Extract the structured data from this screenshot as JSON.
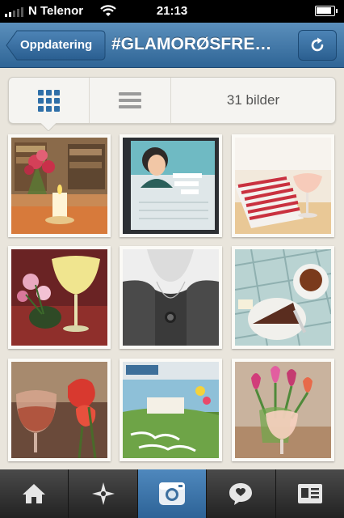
{
  "status_bar": {
    "carrier": "N Telenor",
    "time": "21:13",
    "battery_level": 0.9,
    "signal_bars": 2
  },
  "nav": {
    "back_label": "Oppdatering",
    "title": "#GLAMORØSFREDAG",
    "refresh_icon": "refresh-icon"
  },
  "view_toggle": {
    "selected": "grid",
    "grid_icon": "grid-icon",
    "list_icon": "list-icon",
    "count_label": "31 bilder"
  },
  "photos": [
    {
      "subject": "roses-candle"
    },
    {
      "subject": "retro-card"
    },
    {
      "subject": "striped-napkin-drink"
    },
    {
      "subject": "cocktail-flowers"
    },
    {
      "subject": "necklace"
    },
    {
      "subject": "tea-cake"
    },
    {
      "subject": "wine-roses"
    },
    {
      "subject": "magazine-simple-pleasures"
    },
    {
      "subject": "tulips-drink"
    }
  ],
  "tabs": [
    {
      "icon": "home-icon",
      "active": false
    },
    {
      "icon": "explore-icon",
      "active": false
    },
    {
      "icon": "camera-icon",
      "active": true
    },
    {
      "icon": "news-icon",
      "active": false
    },
    {
      "icon": "profile-icon",
      "active": false
    }
  ],
  "colors": {
    "nav_blue": "#3d74a6",
    "accent": "#2f6fa8",
    "background": "#e9e5dc"
  }
}
